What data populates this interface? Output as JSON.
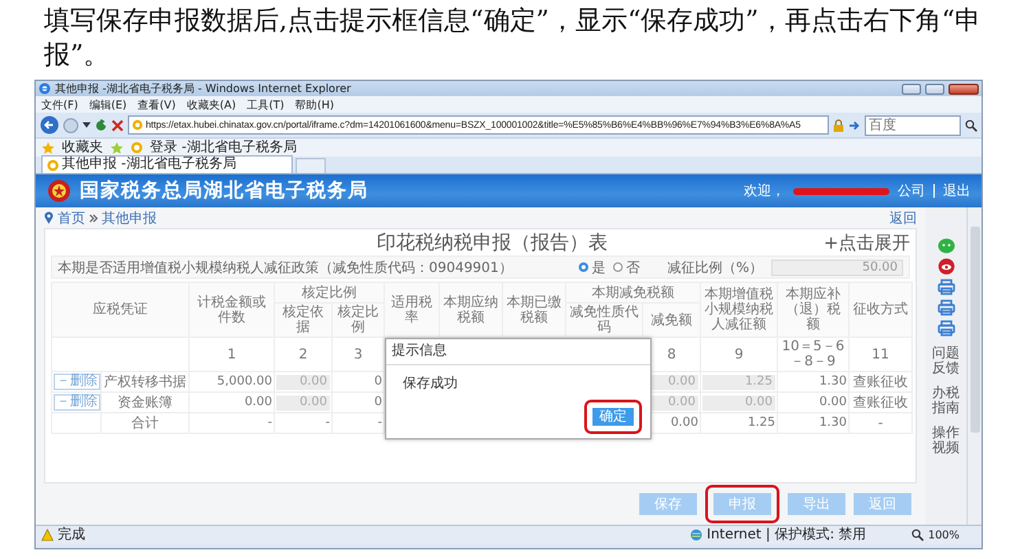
{
  "instruction": "填写保存申报数据后,点击提示框信息“确定”，显示“保存成功”，再点击右下角“申报”。",
  "browser": {
    "title": "其他申报 -湖北省电子税务局 - Windows Internet Explorer",
    "menu": [
      "文件(F)",
      "编辑(E)",
      "查看(V)",
      "收藏夹(A)",
      "工具(T)",
      "帮助(H)"
    ],
    "address": "https://etax.hubei.chinatax.gov.cn/portal/iframe.c?dm=14201061600&menu=BSZX_100001002&title=%E5%85%B6%E4%BB%96%E7%94%B3%E6%8A%A5",
    "search_placeholder": "百度",
    "favorites_label": "收藏夹",
    "favorites": [
      "登录 -湖北省电子税务局"
    ],
    "tab": "其他申报 -湖北省电子税务局"
  },
  "site": {
    "name": "国家税务总局湖北省电子税务局",
    "welcome": "欢迎，",
    "company": "公司",
    "logout": "退出"
  },
  "breadcrumb": [
    "首页",
    "其他申报"
  ],
  "back_link": "返回",
  "form": {
    "title": "印花税纳税申报（报告）表",
    "expand": "+点击展开",
    "info": {
      "label": "本期是否适用增值税小规模纳税人减征政策（减免性质代码：09049901）",
      "options": [
        {
          "label": "是",
          "selected": true
        },
        {
          "label": "否",
          "selected": false
        }
      ],
      "rate_label": "减征比例（%）",
      "rate_value": "50.00"
    },
    "header": [
      {
        "label": "应税凭证"
      },
      {
        "label": "计税金额或件数"
      },
      {
        "label": "核定比例",
        "children": [
          "核定依据",
          "核定比例"
        ]
      },
      {
        "label": "适用税率"
      },
      {
        "label": "本期应纳税额"
      },
      {
        "label": "本期已缴税额"
      },
      {
        "label": "本期减免税额",
        "children": [
          "减免性质代码",
          "减免额"
        ]
      },
      {
        "label": "本期增值税小规模纳税人减征额"
      },
      {
        "label": "本期应补（退）税额"
      },
      {
        "label": "征收方式"
      }
    ],
    "rows": [
      {
        "kind": "numbers",
        "cells": [
          null,
          "1",
          "2",
          "3",
          null,
          null,
          null,
          null,
          "8",
          "9",
          "10＝5－6－8－9",
          "11"
        ]
      },
      {
        "kind": "item",
        "delete": "－删除",
        "cells": [
          "产权转移书据",
          "5,000.00",
          {
            "kind": "input",
            "value": "0.00"
          },
          "0",
          null,
          null,
          null,
          null,
          {
            "kind": "input",
            "value": "0.00"
          },
          {
            "kind": "input",
            "value": "1.25"
          },
          "1.30",
          "查账征收"
        ]
      },
      {
        "kind": "item",
        "delete": "－删除",
        "cells": [
          "资金账簿",
          "0.00",
          {
            "kind": "input",
            "value": "0.00"
          },
          "0",
          null,
          null,
          null,
          null,
          {
            "kind": "input",
            "value": "0.00"
          },
          {
            "kind": "input",
            "value": "0.00"
          },
          "0.00",
          "查账征收"
        ]
      },
      {
        "kind": "total",
        "cells": [
          "合计",
          "-",
          "-",
          "-",
          null,
          null,
          null,
          null,
          "0.00",
          "1.25",
          "1.30",
          "-"
        ]
      }
    ],
    "buttons": [
      {
        "label": "保存",
        "highlighted": false
      },
      {
        "label": "申报",
        "highlighted": true
      },
      {
        "label": "导出",
        "highlighted": false
      },
      {
        "label": "返回",
        "highlighted": false
      }
    ]
  },
  "dialog": {
    "title": "提示信息",
    "message": "保存成功",
    "button": {
      "label": "确定",
      "highlighted": true
    }
  },
  "side_tools": {
    "icons": [
      {
        "kind": "chat",
        "color": "#2fb344"
      },
      {
        "kind": "eye",
        "color": "#d0202a"
      },
      {
        "kind": "printer",
        "color": "#3a7fd5"
      },
      {
        "kind": "printer",
        "color": "#3a7fd5"
      },
      {
        "kind": "printer",
        "color": "#3a7fd5"
      }
    ],
    "links": [
      "问题反馈",
      "办税指南",
      "操作视频"
    ]
  },
  "status_bar": {
    "text": "完成",
    "zone": "Internet | 保护模式: 禁用",
    "zoom": "100%"
  }
}
